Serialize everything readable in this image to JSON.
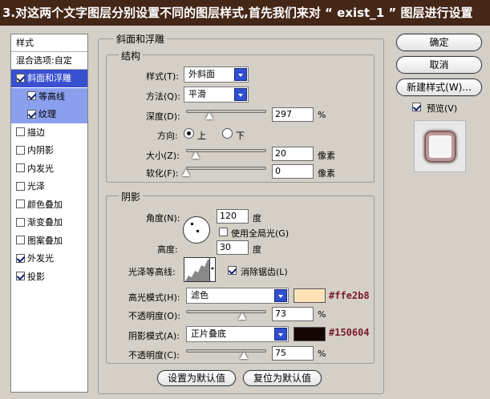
{
  "banner": "3.对这两个文字图层分别设置不同的图层样式,首先我们来对 “ exist_1 ” 图层进行设置",
  "styles_panel": {
    "header": "样式",
    "blend": "混合选项:自定",
    "items": [
      {
        "label": "斜面和浮雕",
        "checked": true
      },
      {
        "label": "等高线",
        "checked": true
      },
      {
        "label": "纹理",
        "checked": true
      },
      {
        "label": "描边",
        "checked": false
      },
      {
        "label": "内阴影",
        "checked": false
      },
      {
        "label": "内发光",
        "checked": false
      },
      {
        "label": "光泽",
        "checked": false
      },
      {
        "label": "颜色叠加",
        "checked": false
      },
      {
        "label": "渐变叠加",
        "checked": false
      },
      {
        "label": "图案叠加",
        "checked": false
      },
      {
        "label": "外发光",
        "checked": true
      },
      {
        "label": "投影",
        "checked": true
      }
    ]
  },
  "bevel": {
    "title": "斜面和浮雕",
    "structure": {
      "title": "结构",
      "style_label": "样式(T):",
      "style_value": "外斜面",
      "method_label": "方法(Q):",
      "method_value": "平滑",
      "depth_label": "深度(D):",
      "depth_value": "297",
      "depth_unit": "%",
      "depth_level": 0.3,
      "direction_label": "方向:",
      "dir_up": "上",
      "dir_down": "下",
      "direction_selected": "上",
      "size_label": "大小(Z):",
      "size_value": "20",
      "size_unit": "像素",
      "size_level": 0.12,
      "soften_label": "软化(F):",
      "soften_value": "0",
      "soften_unit": "像素",
      "soften_level": 0
    },
    "shading": {
      "title": "阴影",
      "angle_label": "角度(N):",
      "angle_value": "120",
      "angle_unit": "度",
      "global_light_label": "使用全局光(G)",
      "global_light_checked": false,
      "altitude_label": "高度:",
      "altitude_value": "30",
      "altitude_unit": "度",
      "gloss_label": "光泽等高线:",
      "antialias_label": "消除锯齿(L)",
      "antialias_checked": true,
      "highlight_label": "高光模式(H):",
      "highlight_mode": "滤色",
      "highlight_color": "#ffe2b8",
      "highlight_hex": "#ffe2b8",
      "hl_opacity_label": "不透明度(O):",
      "hl_opacity_value": "73",
      "hl_opacity_unit": "%",
      "hl_opacity_level": 0.73,
      "shadow_label": "阴影模式(A):",
      "shadow_mode": "正片叠底",
      "shadow_color": "#150604",
      "shadow_hex": "#150604",
      "sh_opacity_label": "不透明度(C):",
      "sh_opacity_value": "75",
      "sh_opacity_unit": "%",
      "sh_opacity_level": 0.75
    },
    "make_default": "设置为默认值",
    "reset_default": "复位为默认值"
  },
  "actions": {
    "ok": "确定",
    "cancel": "取消",
    "new_style": "新建样式(W)...",
    "preview_label": "预览(V)",
    "preview_checked": true
  }
}
